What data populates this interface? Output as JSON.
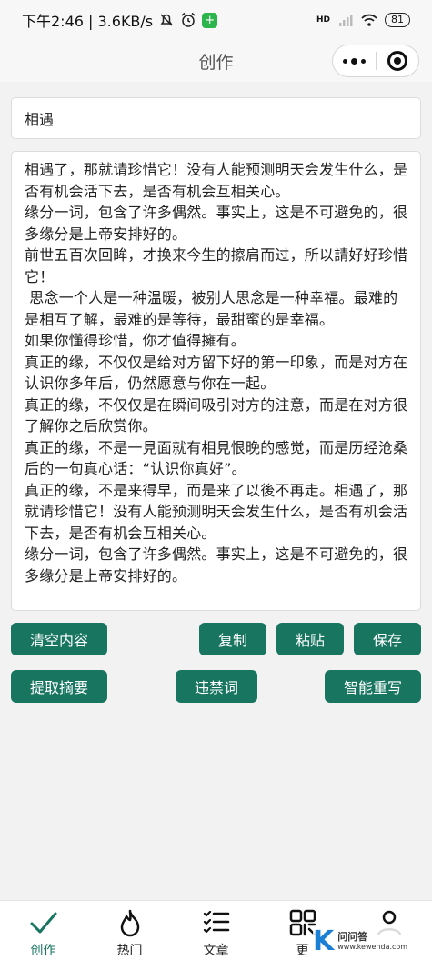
{
  "status_bar": {
    "time_speed": "下午2:46 | 3.6KB/s",
    "network": "HD",
    "battery": "81"
  },
  "nav": {
    "title": "创作"
  },
  "editor": {
    "title_value": "相遇",
    "content": "相遇了，那就请珍惜它！没有人能预测明天会发生什么，是否有机会活下去，是否有机会互相关心。\n缘分一词，包含了许多偶然。事实上，这是不可避免的，很多缘分是上帝安排好的。\n前世五百次回眸，才换来今生的擦肩而过，所以請好好珍惜它！\n 思念一个人是一种温暖，被别人思念是一种幸福。最难的是相互了解，最难的是等待，最甜蜜的是幸福。\n如果你懂得珍惜，你才值得擁有。\n真正的缘，不仅仅是给对方留下好的第一印象，而是对方在认识你多年后，仍然愿意与你在一起。\n真正的缘，不仅仅是在瞬间吸引对方的注意，而是在对方很了解你之后欣赏你。\n真正的缘，不是一見面就有相見恨晚的感觉，而是历经沧桑后的一句真心话：“认识你真好”。\n真正的缘，不是来得早，而是来了以後不再走。相遇了，那就请珍惜它！没有人能预测明天会发生什么，是否有机会活下去，是否有机会互相关心。\n缘分一词，包含了许多偶然。事实上，这是不可避免的，很多缘分是上帝安排好的。"
  },
  "buttons": {
    "clear": "清空内容",
    "copy": "复制",
    "paste": "粘贴",
    "save": "保存",
    "summary": "提取摘要",
    "banned_words": "违禁词",
    "rewrite": "智能重写"
  },
  "tabs": [
    {
      "label": "创作",
      "icon": "check-icon"
    },
    {
      "label": "热门",
      "icon": "flame-icon"
    },
    {
      "label": "文章",
      "icon": "checklist-icon"
    },
    {
      "label": "更",
      "icon": "grid-icon"
    },
    {
      "label": "",
      "icon": "user-icon"
    }
  ],
  "watermark": {
    "letter": "K",
    "main": "问问答",
    "sub": "www.kewenda.com"
  },
  "colors": {
    "accent": "#177560",
    "background": "#f2f2f2"
  }
}
